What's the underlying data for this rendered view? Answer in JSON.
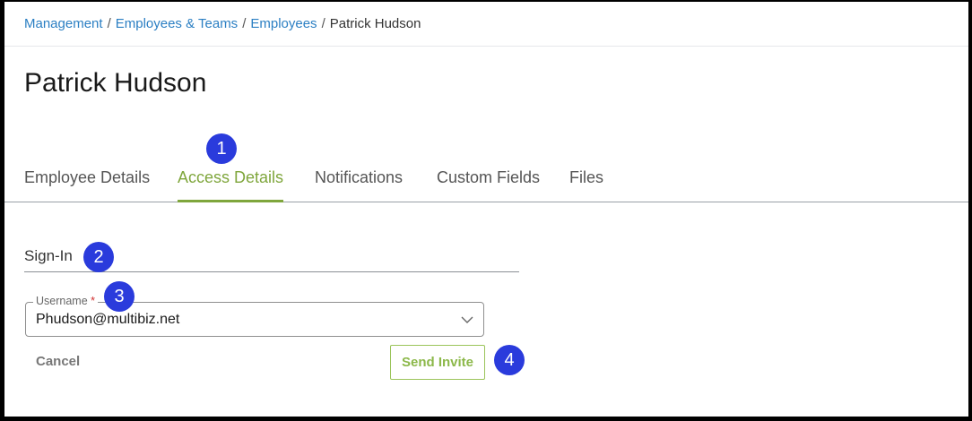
{
  "breadcrumb": {
    "items": [
      "Management",
      "Employees & Teams",
      "Employees"
    ],
    "current": "Patrick Hudson",
    "separator": "/"
  },
  "page": {
    "title": "Patrick Hudson"
  },
  "tabs": [
    {
      "label": "Employee Details",
      "active": false
    },
    {
      "label": "Access Details",
      "active": true
    },
    {
      "label": "Notifications",
      "active": false
    },
    {
      "label": "Custom Fields",
      "active": false
    },
    {
      "label": "Files",
      "active": false
    }
  ],
  "signin": {
    "title": "Sign-In",
    "username": {
      "label": "Username",
      "required_mark": "*",
      "value": "Phudson@multibiz.net"
    },
    "cancel_label": "Cancel",
    "send_invite_label": "Send Invite"
  },
  "markers": [
    "1",
    "2",
    "3",
    "4"
  ],
  "colors": {
    "link": "#2b7fc3",
    "active_tab": "#7fa63c",
    "marker": "#2a3bdc",
    "invite_border": "#9bc45a"
  },
  "icons": {
    "select_chevron": "chevron-down-icon"
  }
}
